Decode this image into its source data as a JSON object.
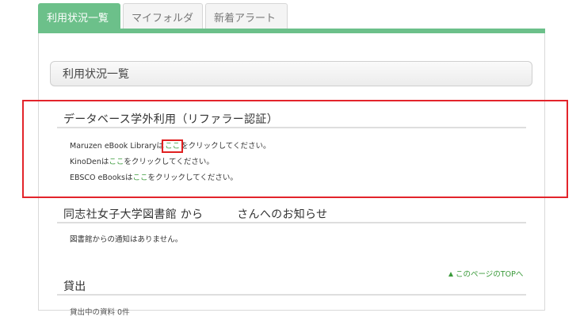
{
  "tabs": [
    {
      "label": "利用状況一覧",
      "active": true
    },
    {
      "label": "マイフォルダ",
      "active": false
    },
    {
      "label": "新着アラート",
      "active": false
    }
  ],
  "section_header": "利用状況一覧",
  "database": {
    "title": "データベース学外利用（リファラー認証）",
    "items": [
      {
        "prefix": "Maruzen eBook Library",
        "mid": "は",
        "link": "ここ",
        "suffix": "をクリックしてください。"
      },
      {
        "prefix": "KinoDen",
        "mid": "は",
        "link": "ここ",
        "suffix": "をクリックしてください。"
      },
      {
        "prefix": "EBSCO eBooks",
        "mid": "は",
        "link": "ここ",
        "suffix": "をクリックしてください。"
      }
    ]
  },
  "notice": {
    "title": "同志社女子大学図書館 から　　　さんへのお知らせ",
    "body": "図書館からの通知はありません。"
  },
  "page_top_link": "このページのTOPへ",
  "loans": {
    "title": "貸出",
    "partial": "貸出中の資料 0件"
  },
  "colors": {
    "accent": "#6cc08a",
    "link": "#3a9a3a",
    "highlight": "#e3242b"
  }
}
